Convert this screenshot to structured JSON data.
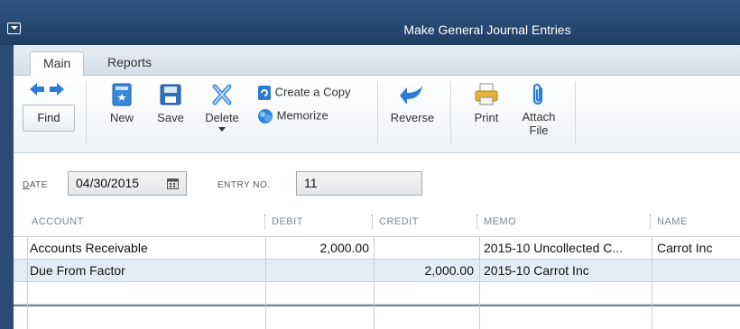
{
  "window": {
    "title": "Make General Journal Entries"
  },
  "tabs": [
    {
      "label": "Main",
      "active": true
    },
    {
      "label": "Reports",
      "active": false
    }
  ],
  "toolbar": {
    "find": "Find",
    "new": "New",
    "save": "Save",
    "delete": "Delete",
    "create_copy": "Create a Copy",
    "memorize": "Memorize",
    "reverse": "Reverse",
    "print": "Print",
    "attach_line1": "Attach",
    "attach_line2": "File"
  },
  "form": {
    "date_label_first": "D",
    "date_label_rest": "ATE",
    "date_value": "04/30/2015",
    "entry_label": "ENTRY NO.",
    "entry_value": "11"
  },
  "grid": {
    "columns": [
      "ACCOUNT",
      "DEBIT",
      "CREDIT",
      "MEMO",
      "NAME"
    ],
    "rows": [
      {
        "account": "Accounts Receivable",
        "debit": "2,000.00",
        "credit": "",
        "memo": "2015-10 Uncollected C...",
        "name": "Carrot Inc"
      },
      {
        "account": "Due From Factor",
        "debit": "",
        "credit": "2,000.00",
        "memo": "2015-10 Carrot Inc",
        "name": ""
      }
    ]
  },
  "colors": {
    "titlebar": "#1f3f64",
    "selected_row": "#e3edf8",
    "icon_blue": "#2e7bd6",
    "icon_yellow": "#e8b43a"
  }
}
